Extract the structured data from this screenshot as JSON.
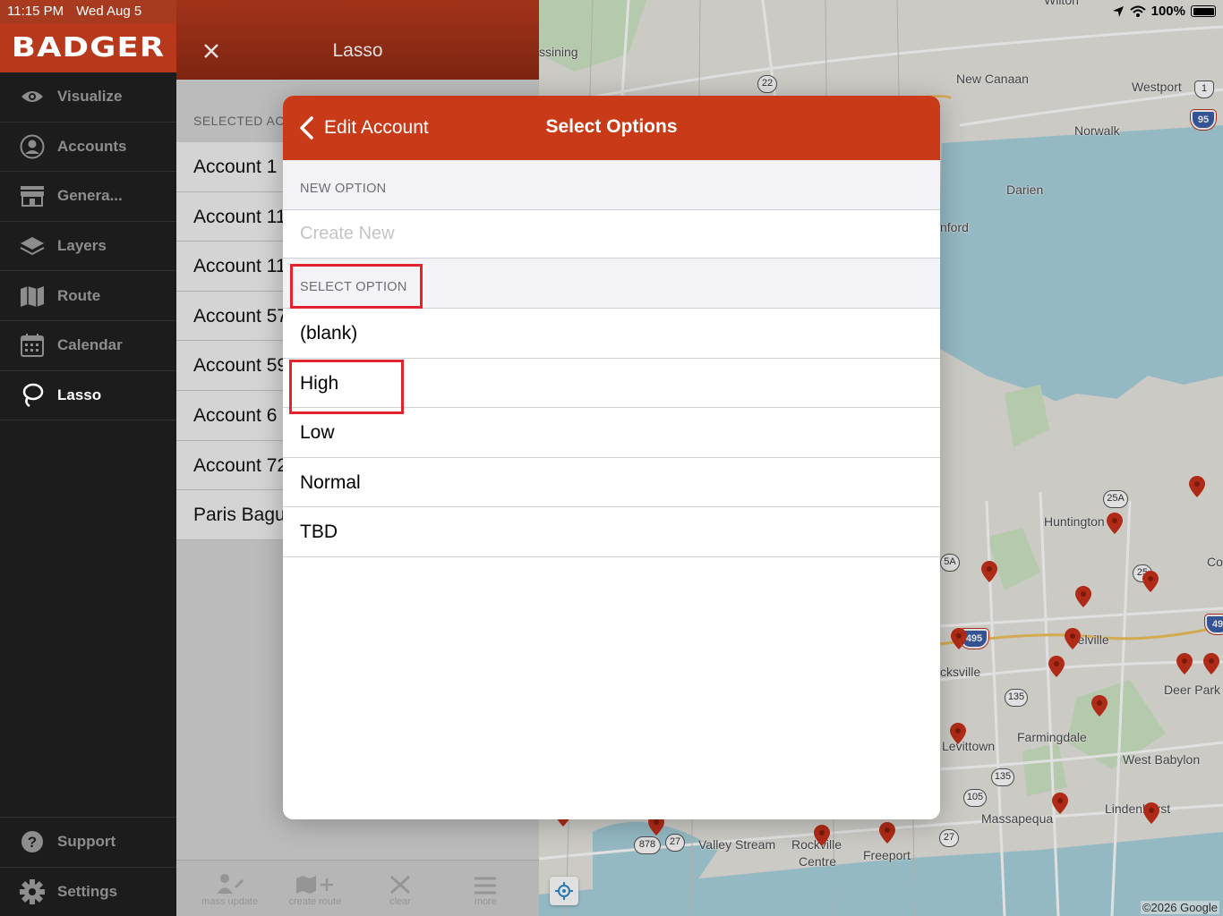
{
  "status_bar": {
    "time": "11:15 PM",
    "date": "Wed Aug 5",
    "battery": "100%"
  },
  "brand": {
    "logo_text": "BADGER",
    "color": "#b8381c"
  },
  "sidebar": {
    "items": [
      {
        "label": "Visualize",
        "icon": "eye-icon"
      },
      {
        "label": "Accounts",
        "icon": "person-circle-icon"
      },
      {
        "label": "Genera...",
        "icon": "storefront-icon"
      },
      {
        "label": "Layers",
        "icon": "layers-icon"
      },
      {
        "label": "Route",
        "icon": "map-icon"
      },
      {
        "label": "Calendar",
        "icon": "calendar-icon"
      },
      {
        "label": "Lasso",
        "icon": "lasso-icon",
        "active": true
      }
    ],
    "bottom_items": [
      {
        "label": "Support",
        "icon": "question-circle-icon"
      },
      {
        "label": "Settings",
        "icon": "gear-icon"
      }
    ]
  },
  "lasso": {
    "title": "Lasso",
    "section_header": "SELECTED AC",
    "accounts": [
      "Account 1",
      "Account 11",
      "Account 11",
      "Account 57",
      "Account 59",
      "Account 6",
      "Account 72",
      "Paris Bagu"
    ],
    "toolbar": [
      {
        "label": "mass update",
        "icon": "person-edit-icon"
      },
      {
        "label": "create route",
        "icon": "map-plus-icon"
      },
      {
        "label": "clear",
        "icon": "x-icon"
      },
      {
        "label": "more",
        "icon": "hamburger-icon"
      }
    ]
  },
  "modal": {
    "back_label": "Edit Account",
    "title": "Select Options",
    "new_option_header": "NEW OPTION",
    "create_placeholder": "Create New",
    "select_option_header": "SELECT OPTION",
    "options": [
      "(blank)",
      "High",
      "Low",
      "Normal",
      "TBD"
    ]
  },
  "map": {
    "labels": [
      "ssining",
      "New Canaan",
      "Westport",
      "Norwalk",
      "Darien",
      "nford",
      "Huntington",
      "Co",
      "Melville",
      "cksville",
      "Deer Park",
      "Farmingdale",
      "Levittown",
      "West Babylon",
      "Massapequa",
      "Lindenhurst",
      "Valley Stream",
      "Rockville",
      "Centre",
      "Freeport",
      "Wilton"
    ],
    "shields": [
      "22",
      "25A",
      "25",
      "135",
      "135",
      "105",
      "27",
      "27",
      "878",
      "5A"
    ],
    "interstates": [
      "95",
      "495",
      "49"
    ],
    "us_route": "1",
    "copyright": "©2026 Google",
    "water_color": "#a9d3df",
    "land_color": "#e7e6e1",
    "park_color": "#cfe5c4",
    "pin_color": "#c8321b"
  }
}
